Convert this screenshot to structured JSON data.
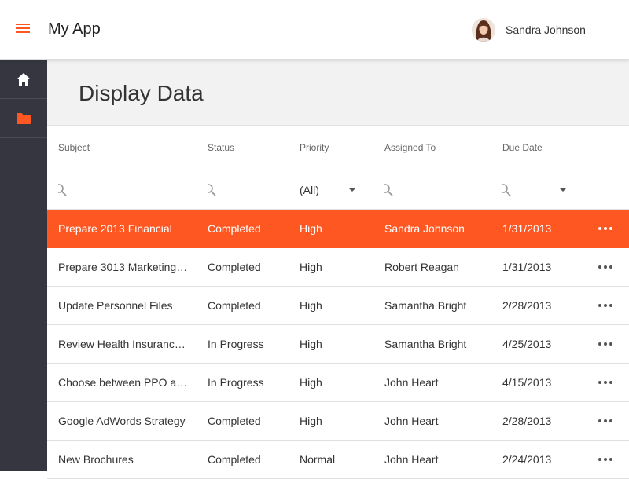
{
  "app": {
    "title": "My App"
  },
  "user": {
    "name": "Sandra Johnson"
  },
  "sidebar": {
    "items": [
      {
        "icon": "home-icon",
        "color": "#ffffff"
      },
      {
        "icon": "folder-icon",
        "color": "#ff5722"
      }
    ]
  },
  "page": {
    "title": "Display Data"
  },
  "table": {
    "columns": [
      "Subject",
      "Status",
      "Priority",
      "Assigned To",
      "Due Date"
    ],
    "filters": {
      "priority_value": "(All)"
    },
    "rows": [
      {
        "subject": "Prepare 2013 Financial",
        "status": "Completed",
        "priority": "High",
        "assigned": "Sandra Johnson",
        "due": "1/31/2013",
        "selected": true
      },
      {
        "subject": "Prepare 3013 Marketing…",
        "status": "Completed",
        "priority": "High",
        "assigned": "Robert Reagan",
        "due": "1/31/2013"
      },
      {
        "subject": "Update Personnel Files",
        "status": "Completed",
        "priority": "High",
        "assigned": "Samantha Bright",
        "due": "2/28/2013"
      },
      {
        "subject": "Review Health Insuranc…",
        "status": "In Progress",
        "priority": "High",
        "assigned": "Samantha Bright",
        "due": "4/25/2013"
      },
      {
        "subject": "Choose between PPO a…",
        "status": "In Progress",
        "priority": "High",
        "assigned": "John Heart",
        "due": "4/15/2013"
      },
      {
        "subject": "Google AdWords Strategy",
        "status": "Completed",
        "priority": "High",
        "assigned": "John Heart",
        "due": "2/28/2013"
      },
      {
        "subject": "New Brochures",
        "status": "Completed",
        "priority": "Normal",
        "assigned": "John Heart",
        "due": "2/24/2013"
      }
    ]
  },
  "colors": {
    "accent": "#ff5722",
    "sidebar_bg": "#363640",
    "page_head_bg": "#f2f2f2"
  }
}
